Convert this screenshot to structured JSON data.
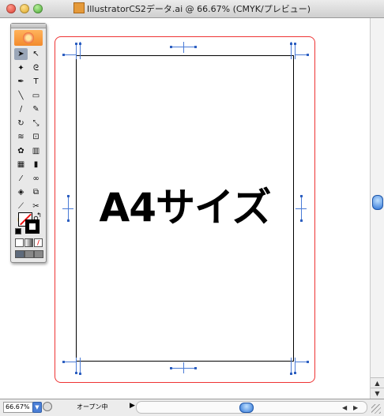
{
  "window": {
    "title": "IllustratorCS2データ.ai @ 66.67% (CMYK/プレビュー)"
  },
  "canvas": {
    "page_text": "A4サイズ"
  },
  "statusbar": {
    "zoom_value": "66.67%",
    "status_text": "オープン中"
  },
  "icons": {
    "document": "illustrator-document-icon",
    "close": "close-button",
    "minimize": "minimize-button",
    "zoom": "zoom-button"
  },
  "toolbox": {
    "tools": [
      {
        "name": "selection-tool-icon",
        "glyph": "➤"
      },
      {
        "name": "direct-selection-tool-icon",
        "glyph": "↖"
      },
      {
        "name": "magic-wand-tool-icon",
        "glyph": "✦"
      },
      {
        "name": "lasso-tool-icon",
        "glyph": "ᘓ"
      },
      {
        "name": "pen-tool-icon",
        "glyph": "✒"
      },
      {
        "name": "type-tool-icon",
        "glyph": "T"
      },
      {
        "name": "line-segment-tool-icon",
        "glyph": "╲"
      },
      {
        "name": "rectangle-tool-icon",
        "glyph": "▭"
      },
      {
        "name": "paintbrush-tool-icon",
        "glyph": "∕"
      },
      {
        "name": "pencil-tool-icon",
        "glyph": "✎"
      },
      {
        "name": "rotate-tool-icon",
        "glyph": "↻"
      },
      {
        "name": "scale-tool-icon",
        "glyph": "⤡"
      },
      {
        "name": "warp-tool-icon",
        "glyph": "≋"
      },
      {
        "name": "free-transform-tool-icon",
        "glyph": "⊡"
      },
      {
        "name": "symbol-sprayer-tool-icon",
        "glyph": "✿"
      },
      {
        "name": "graph-tool-icon",
        "glyph": "▥"
      },
      {
        "name": "mesh-tool-icon",
        "glyph": "▦"
      },
      {
        "name": "gradient-tool-icon",
        "glyph": "▮"
      },
      {
        "name": "eyedropper-tool-icon",
        "glyph": "⁄"
      },
      {
        "name": "blend-tool-icon",
        "glyph": "∞"
      },
      {
        "name": "live-paint-bucket-tool-icon",
        "glyph": "◈"
      },
      {
        "name": "live-paint-selection-tool-icon",
        "glyph": "⧉"
      },
      {
        "name": "slice-tool-icon",
        "glyph": "⟋"
      },
      {
        "name": "scissors-tool-icon",
        "glyph": "✂"
      },
      {
        "name": "hand-tool-icon",
        "glyph": "✋"
      },
      {
        "name": "zoom-tool-icon",
        "glyph": "⚲"
      }
    ]
  },
  "colors": {
    "bleed_line": "#e33333",
    "trim_marks": "#4a7bd6",
    "scroll_thumb": "#2f75d6"
  }
}
